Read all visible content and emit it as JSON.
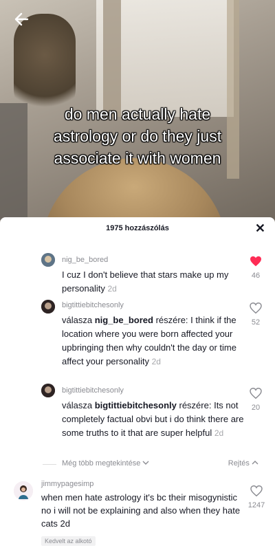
{
  "video": {
    "caption_lines": [
      "do men actually hate",
      "astrology or do they just",
      "associate it with women"
    ]
  },
  "sheet": {
    "comment_count": "1975 hozzászólás",
    "close_label": "✕"
  },
  "replies": [
    {
      "username": "nig_be_bored",
      "text": "I cuz I don't believe that stars make up my personality",
      "time": "2d",
      "likes": "46",
      "liked": true
    },
    {
      "username": "bigtittiebitchesonly",
      "reply_prefix": "válasza",
      "reply_to": "nig_be_bored",
      "reply_suffix": "részére:",
      "text": " I think if the location where you were born affected your upbringing then why couldn't the day or time affect your personality",
      "time": "2d",
      "likes": "52",
      "liked": false
    },
    {
      "username": "bigtittiebitchesonly",
      "reply_prefix": "válasza",
      "reply_to": "bigtittiebitchesonly",
      "reply_suffix": "részére:",
      "text": " Its not completely factual obvi but i do think there are some truths to it that are super helpful",
      "time": "2d",
      "likes": "20",
      "liked": false
    }
  ],
  "thread_controls": {
    "see_more": "Még több megtekintése",
    "hide": "Rejtés"
  },
  "comment": {
    "username": "jimmypagesimp",
    "text": "when men hate astrology it's bc their misogynistic no i will not be explaining and also when they hate cats",
    "time": "2d",
    "likes": "1247",
    "creator_badge": "Kedvelt az alkotó"
  },
  "colors": {
    "liked_heart": "#fe2c55",
    "text_primary": "#161823",
    "text_secondary": "#8a8b91"
  }
}
